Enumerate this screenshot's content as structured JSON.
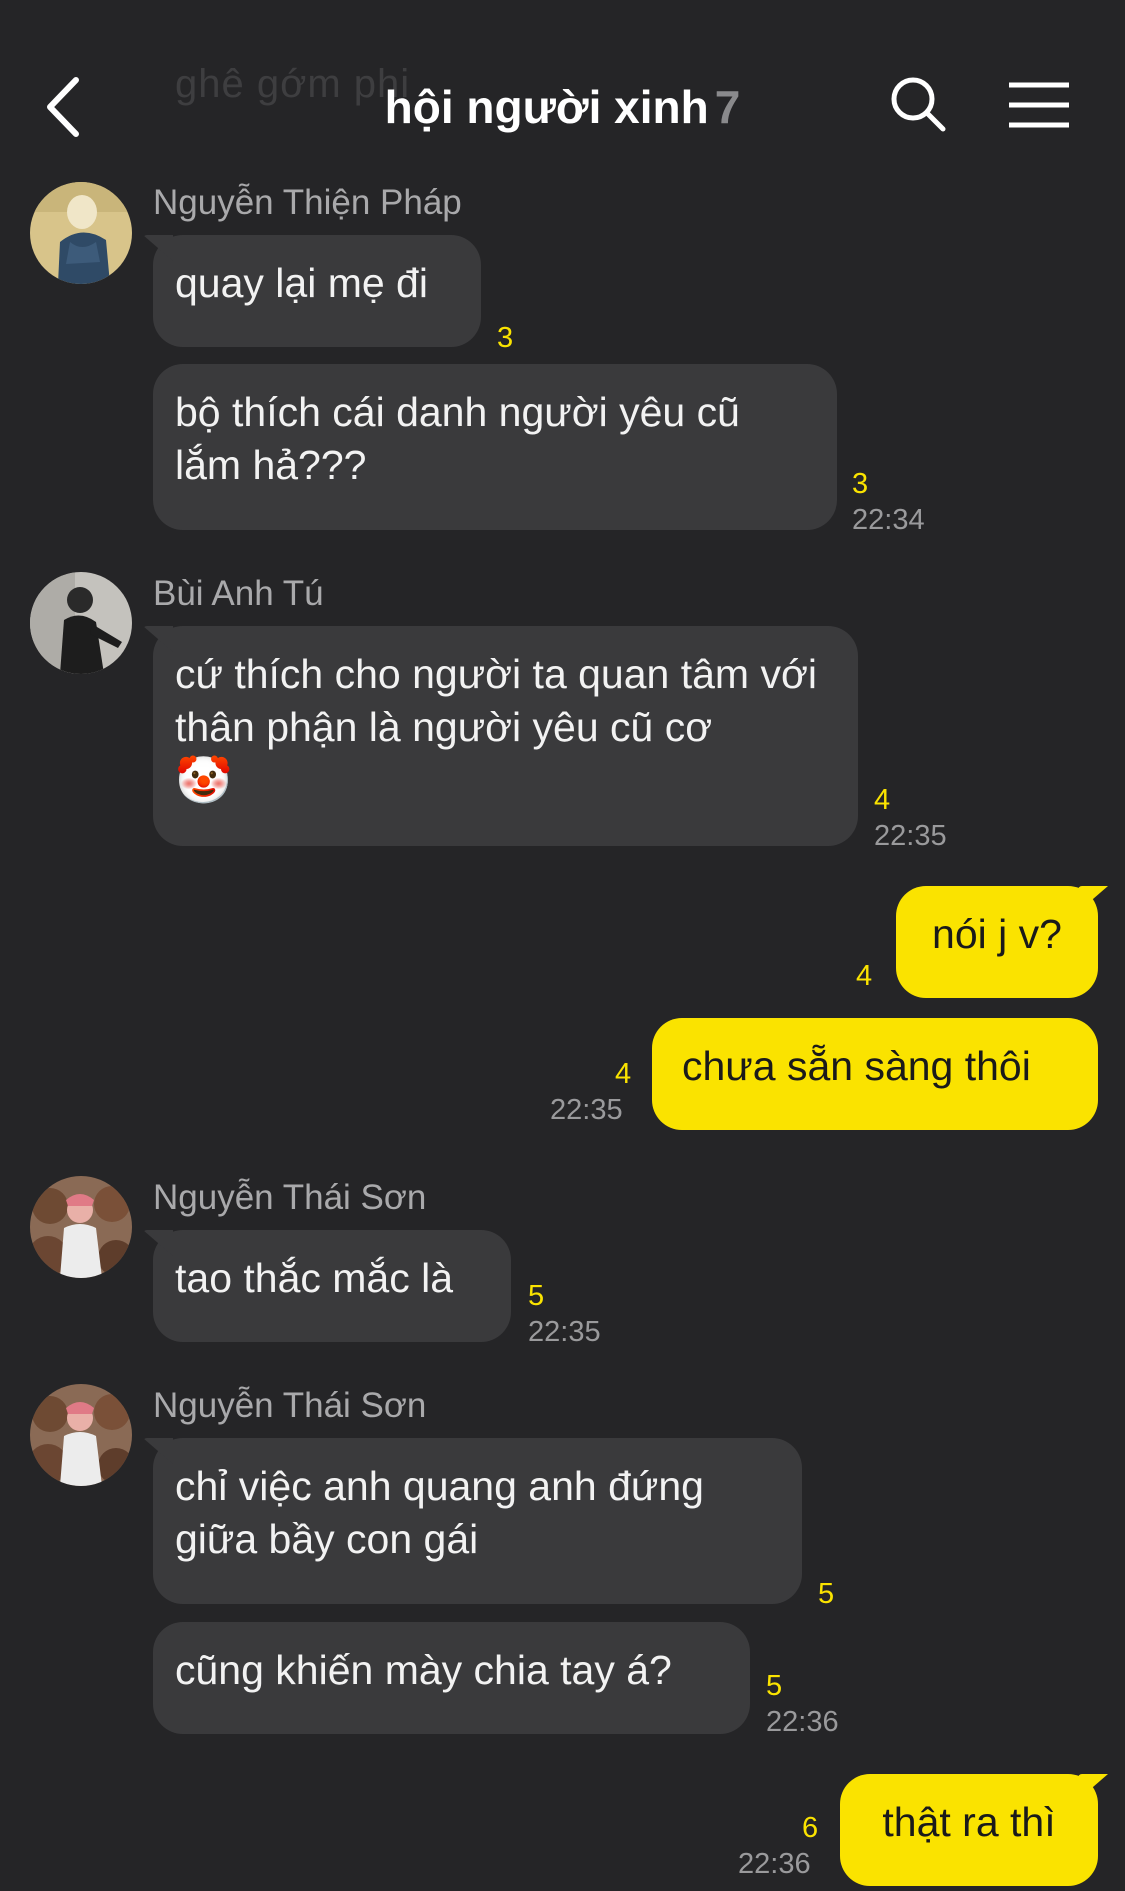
{
  "header": {
    "ghost_text": "ghê gớm phi",
    "title": "hội người xinh",
    "member_count": "7",
    "icons": {
      "back": "chevron-left-icon",
      "search": "search-icon",
      "menu": "hamburger-menu-icon"
    }
  },
  "messages": {
    "m1": {
      "sender": "Nguyễn Thiện Pháp",
      "text": "quay lại mẹ đi",
      "unread": "3"
    },
    "m2": {
      "text": "bộ thích cái danh người yêu cũ lắm hả???",
      "unread": "3",
      "time": "22:34"
    },
    "m3": {
      "sender": "Bùi Anh Tú",
      "text": "cứ thích cho người ta quan tâm với thân phận là người yêu cũ cơ",
      "emoji": "🤡",
      "unread": "4",
      "time": "22:35"
    },
    "m4": {
      "text": "nói j v?",
      "unread": "4"
    },
    "m5": {
      "text": "chưa sẵn sàng thôi",
      "unread": "4",
      "time": "22:35"
    },
    "m6": {
      "sender": "Nguyễn Thái Sơn",
      "text": "tao thắc mắc là",
      "unread": "5",
      "time": "22:35"
    },
    "m7": {
      "sender": "Nguyễn Thái Sơn",
      "text": "chỉ việc anh quang anh đứng giữa bầy con gái",
      "unread": "5"
    },
    "m8": {
      "text": "cũng khiến mày chia tay á?",
      "unread": "5",
      "time": "22:36"
    },
    "m9": {
      "text": "thật ra thì",
      "unread": "6",
      "time": "22:36"
    }
  },
  "colors": {
    "background": "#252527",
    "incoming_bubble": "#3a3a3c",
    "outgoing_bubble": "#fae300",
    "unread_count": "#fae300"
  }
}
